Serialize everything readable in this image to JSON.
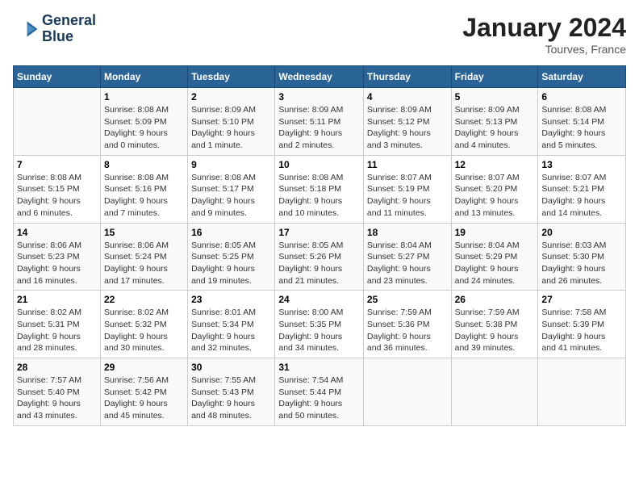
{
  "header": {
    "logo_line1": "General",
    "logo_line2": "Blue",
    "title": "January 2024",
    "subtitle": "Tourves, France"
  },
  "days_of_week": [
    "Sunday",
    "Monday",
    "Tuesday",
    "Wednesday",
    "Thursday",
    "Friday",
    "Saturday"
  ],
  "weeks": [
    [
      {
        "day": "",
        "info": ""
      },
      {
        "day": "1",
        "info": "Sunrise: 8:08 AM\nSunset: 5:09 PM\nDaylight: 9 hours\nand 0 minutes."
      },
      {
        "day": "2",
        "info": "Sunrise: 8:09 AM\nSunset: 5:10 PM\nDaylight: 9 hours\nand 1 minute."
      },
      {
        "day": "3",
        "info": "Sunrise: 8:09 AM\nSunset: 5:11 PM\nDaylight: 9 hours\nand 2 minutes."
      },
      {
        "day": "4",
        "info": "Sunrise: 8:09 AM\nSunset: 5:12 PM\nDaylight: 9 hours\nand 3 minutes."
      },
      {
        "day": "5",
        "info": "Sunrise: 8:09 AM\nSunset: 5:13 PM\nDaylight: 9 hours\nand 4 minutes."
      },
      {
        "day": "6",
        "info": "Sunrise: 8:08 AM\nSunset: 5:14 PM\nDaylight: 9 hours\nand 5 minutes."
      }
    ],
    [
      {
        "day": "7",
        "info": "Sunrise: 8:08 AM\nSunset: 5:15 PM\nDaylight: 9 hours\nand 6 minutes."
      },
      {
        "day": "8",
        "info": "Sunrise: 8:08 AM\nSunset: 5:16 PM\nDaylight: 9 hours\nand 7 minutes."
      },
      {
        "day": "9",
        "info": "Sunrise: 8:08 AM\nSunset: 5:17 PM\nDaylight: 9 hours\nand 9 minutes."
      },
      {
        "day": "10",
        "info": "Sunrise: 8:08 AM\nSunset: 5:18 PM\nDaylight: 9 hours\nand 10 minutes."
      },
      {
        "day": "11",
        "info": "Sunrise: 8:07 AM\nSunset: 5:19 PM\nDaylight: 9 hours\nand 11 minutes."
      },
      {
        "day": "12",
        "info": "Sunrise: 8:07 AM\nSunset: 5:20 PM\nDaylight: 9 hours\nand 13 minutes."
      },
      {
        "day": "13",
        "info": "Sunrise: 8:07 AM\nSunset: 5:21 PM\nDaylight: 9 hours\nand 14 minutes."
      }
    ],
    [
      {
        "day": "14",
        "info": "Sunrise: 8:06 AM\nSunset: 5:23 PM\nDaylight: 9 hours\nand 16 minutes."
      },
      {
        "day": "15",
        "info": "Sunrise: 8:06 AM\nSunset: 5:24 PM\nDaylight: 9 hours\nand 17 minutes."
      },
      {
        "day": "16",
        "info": "Sunrise: 8:05 AM\nSunset: 5:25 PM\nDaylight: 9 hours\nand 19 minutes."
      },
      {
        "day": "17",
        "info": "Sunrise: 8:05 AM\nSunset: 5:26 PM\nDaylight: 9 hours\nand 21 minutes."
      },
      {
        "day": "18",
        "info": "Sunrise: 8:04 AM\nSunset: 5:27 PM\nDaylight: 9 hours\nand 23 minutes."
      },
      {
        "day": "19",
        "info": "Sunrise: 8:04 AM\nSunset: 5:29 PM\nDaylight: 9 hours\nand 24 minutes."
      },
      {
        "day": "20",
        "info": "Sunrise: 8:03 AM\nSunset: 5:30 PM\nDaylight: 9 hours\nand 26 minutes."
      }
    ],
    [
      {
        "day": "21",
        "info": "Sunrise: 8:02 AM\nSunset: 5:31 PM\nDaylight: 9 hours\nand 28 minutes."
      },
      {
        "day": "22",
        "info": "Sunrise: 8:02 AM\nSunset: 5:32 PM\nDaylight: 9 hours\nand 30 minutes."
      },
      {
        "day": "23",
        "info": "Sunrise: 8:01 AM\nSunset: 5:34 PM\nDaylight: 9 hours\nand 32 minutes."
      },
      {
        "day": "24",
        "info": "Sunrise: 8:00 AM\nSunset: 5:35 PM\nDaylight: 9 hours\nand 34 minutes."
      },
      {
        "day": "25",
        "info": "Sunrise: 7:59 AM\nSunset: 5:36 PM\nDaylight: 9 hours\nand 36 minutes."
      },
      {
        "day": "26",
        "info": "Sunrise: 7:59 AM\nSunset: 5:38 PM\nDaylight: 9 hours\nand 39 minutes."
      },
      {
        "day": "27",
        "info": "Sunrise: 7:58 AM\nSunset: 5:39 PM\nDaylight: 9 hours\nand 41 minutes."
      }
    ],
    [
      {
        "day": "28",
        "info": "Sunrise: 7:57 AM\nSunset: 5:40 PM\nDaylight: 9 hours\nand 43 minutes."
      },
      {
        "day": "29",
        "info": "Sunrise: 7:56 AM\nSunset: 5:42 PM\nDaylight: 9 hours\nand 45 minutes."
      },
      {
        "day": "30",
        "info": "Sunrise: 7:55 AM\nSunset: 5:43 PM\nDaylight: 9 hours\nand 48 minutes."
      },
      {
        "day": "31",
        "info": "Sunrise: 7:54 AM\nSunset: 5:44 PM\nDaylight: 9 hours\nand 50 minutes."
      },
      {
        "day": "",
        "info": ""
      },
      {
        "day": "",
        "info": ""
      },
      {
        "day": "",
        "info": ""
      }
    ]
  ]
}
